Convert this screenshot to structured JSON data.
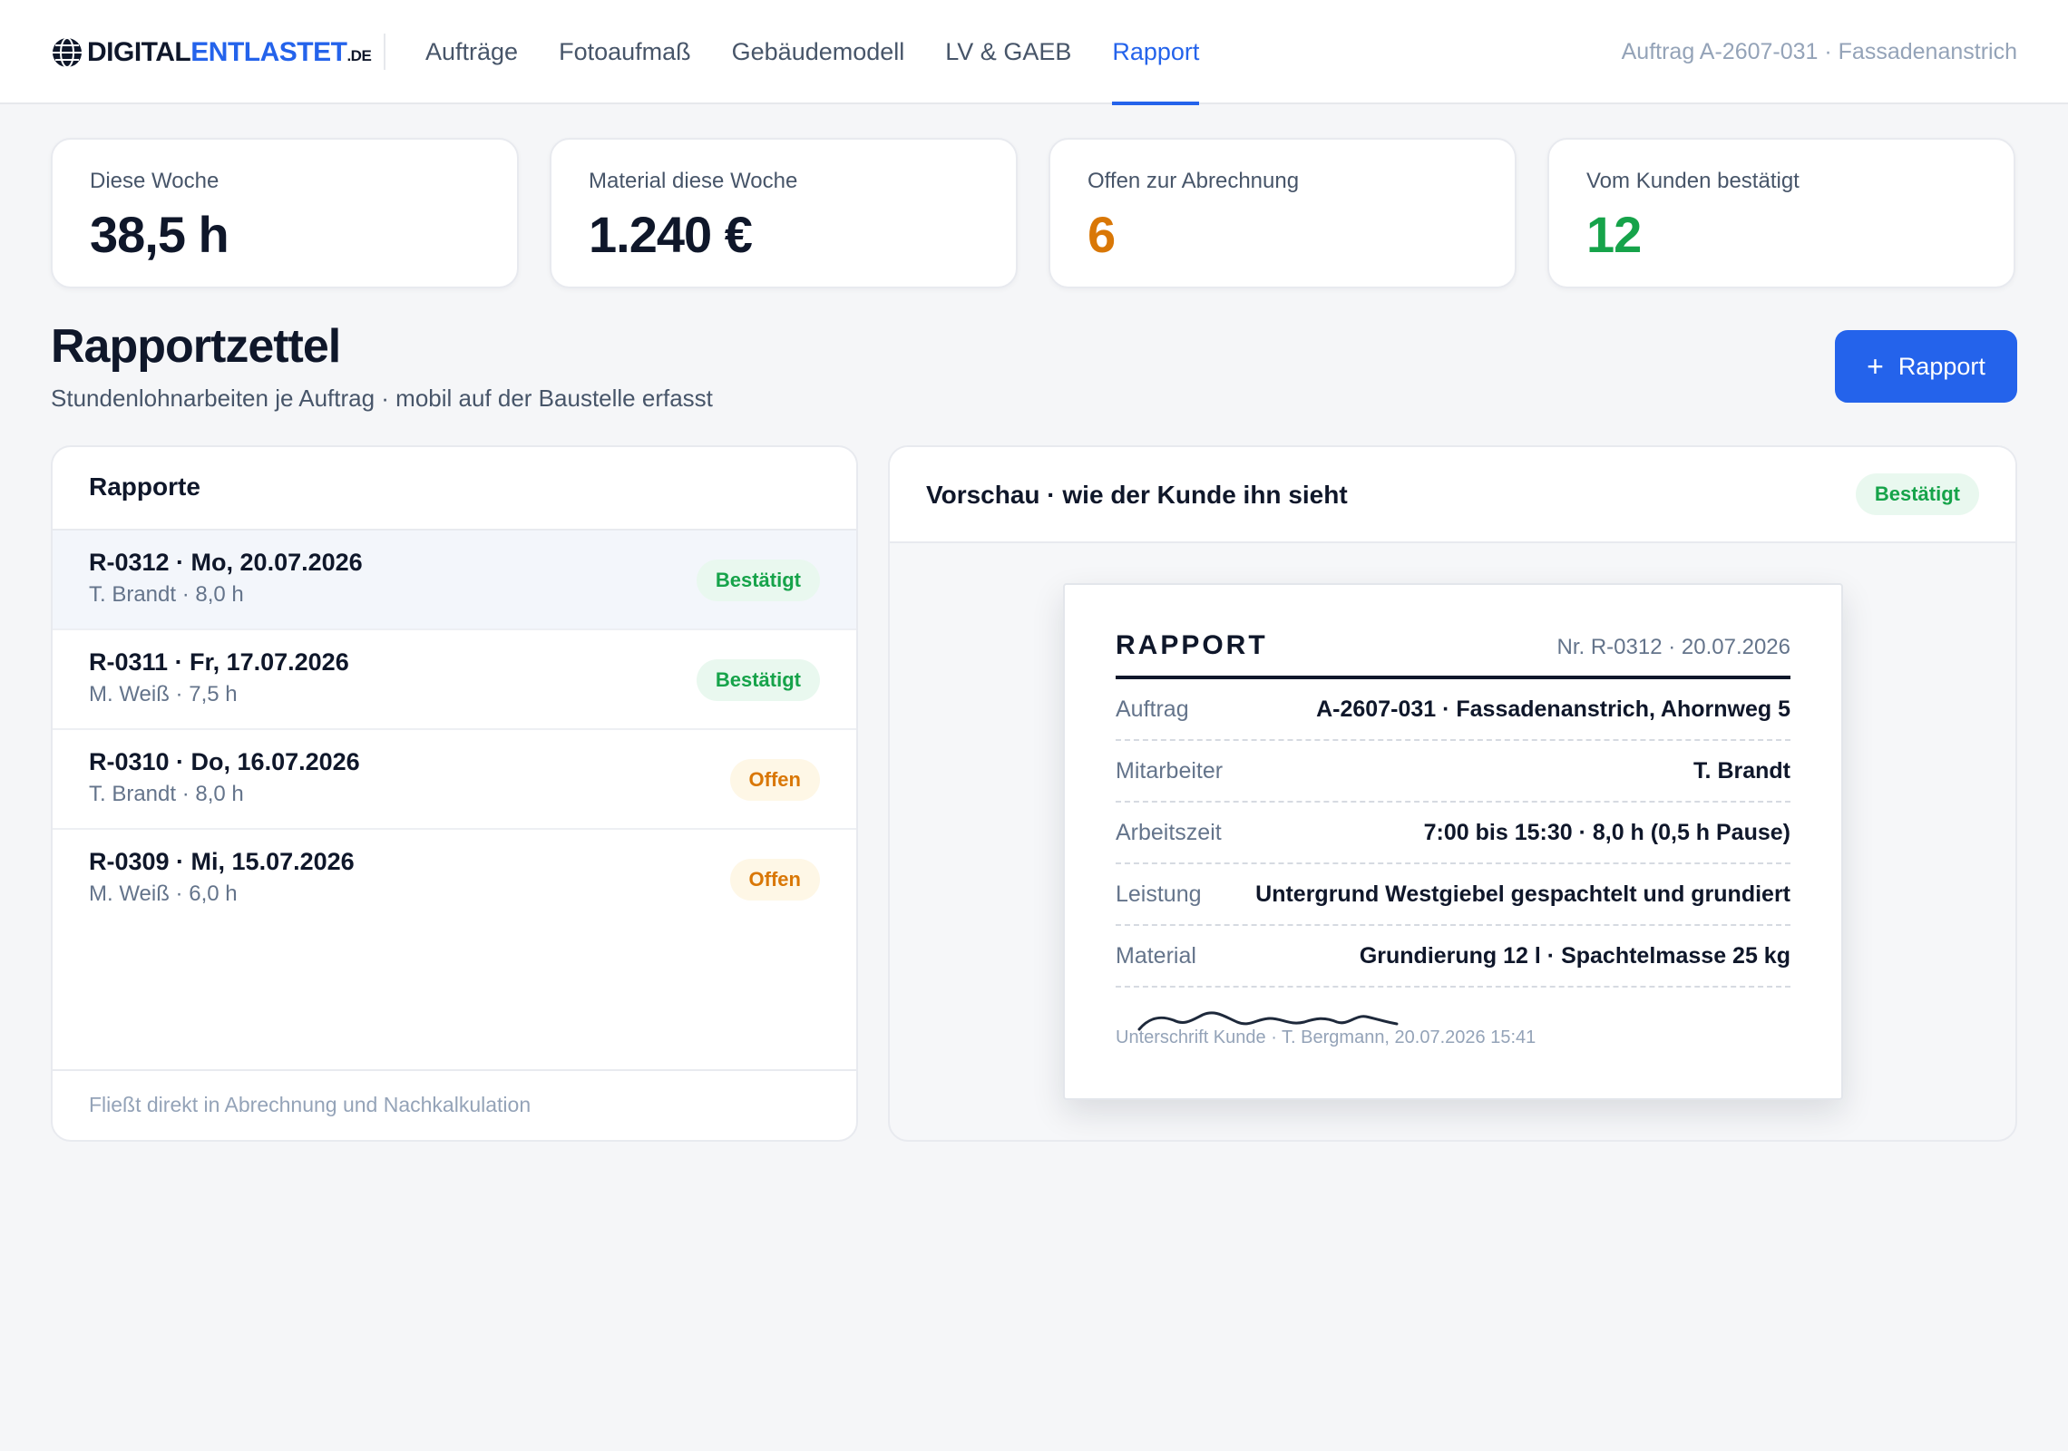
{
  "brand": {
    "part1": "DIGITAL",
    "part2": "ENTLASTET",
    "tld": ".DE"
  },
  "nav": [
    {
      "label": "Aufträge"
    },
    {
      "label": "Fotoaufmaß"
    },
    {
      "label": "Gebäudemodell"
    },
    {
      "label": "LV & GAEB"
    },
    {
      "label": "Rapport",
      "active": true
    }
  ],
  "order_ref": "Auftrag A-2607-031 · Fassadenanstrich",
  "kpis": [
    {
      "label": "Diese Woche",
      "value": "38,5 h"
    },
    {
      "label": "Material diese Woche",
      "value": "1.240 €"
    },
    {
      "label": "Offen zur Abrechnung",
      "value": "6",
      "color": "#d97706"
    },
    {
      "label": "Vom Kunden bestätigt",
      "value": "12",
      "color": "#16a34a"
    }
  ],
  "section": {
    "title": "Rapportzettel",
    "subtitle": "Stundenlohnarbeiten je Auftrag · mobil auf der Baustelle erfasst",
    "add_button": "Rapport"
  },
  "list": {
    "title": "Rapporte",
    "items": [
      {
        "title": "R-0312 · Mo, 20.07.2026",
        "sub": "T. Brandt · 8,0 h",
        "status": "Bestätigt",
        "selected": true
      },
      {
        "title": "R-0311 · Fr, 17.07.2026",
        "sub": "M. Weiß · 7,5 h",
        "status": "Bestätigt"
      },
      {
        "title": "R-0310 · Do, 16.07.2026",
        "sub": "T. Brandt · 8,0 h",
        "status": "Offen"
      },
      {
        "title": "R-0309 · Mi, 15.07.2026",
        "sub": "M. Weiß · 6,0 h",
        "status": "Offen"
      }
    ],
    "footer": "Fließt direkt in Abrechnung und Nachkalkulation"
  },
  "preview": {
    "title": "Vorschau · wie der Kunde ihn sieht",
    "status": "Bestätigt",
    "sheet": {
      "heading": "RAPPORT",
      "number": "Nr. R-0312 · 20.07.2026",
      "rows": [
        {
          "key": "Auftrag",
          "value": "A-2607-031 · Fassadenanstrich, Ahornweg 5"
        },
        {
          "key": "Mitarbeiter",
          "value": "T. Brandt"
        },
        {
          "key": "Arbeitszeit",
          "value": "7:00 bis 15:30 · 8,0 h (0,5 h Pause)"
        },
        {
          "key": "Leistung",
          "value": "Untergrund Westgiebel gespachtelt und grundiert"
        },
        {
          "key": "Material",
          "value": "Grundierung 12 l · Spachtelmasse 25 kg"
        }
      ],
      "signature_caption": "Unterschrift Kunde · T. Bergmann, 20.07.2026 15:41"
    }
  },
  "colors": {
    "accent": "#2463eb",
    "ok": "#16a34a",
    "open": "#d97706"
  }
}
